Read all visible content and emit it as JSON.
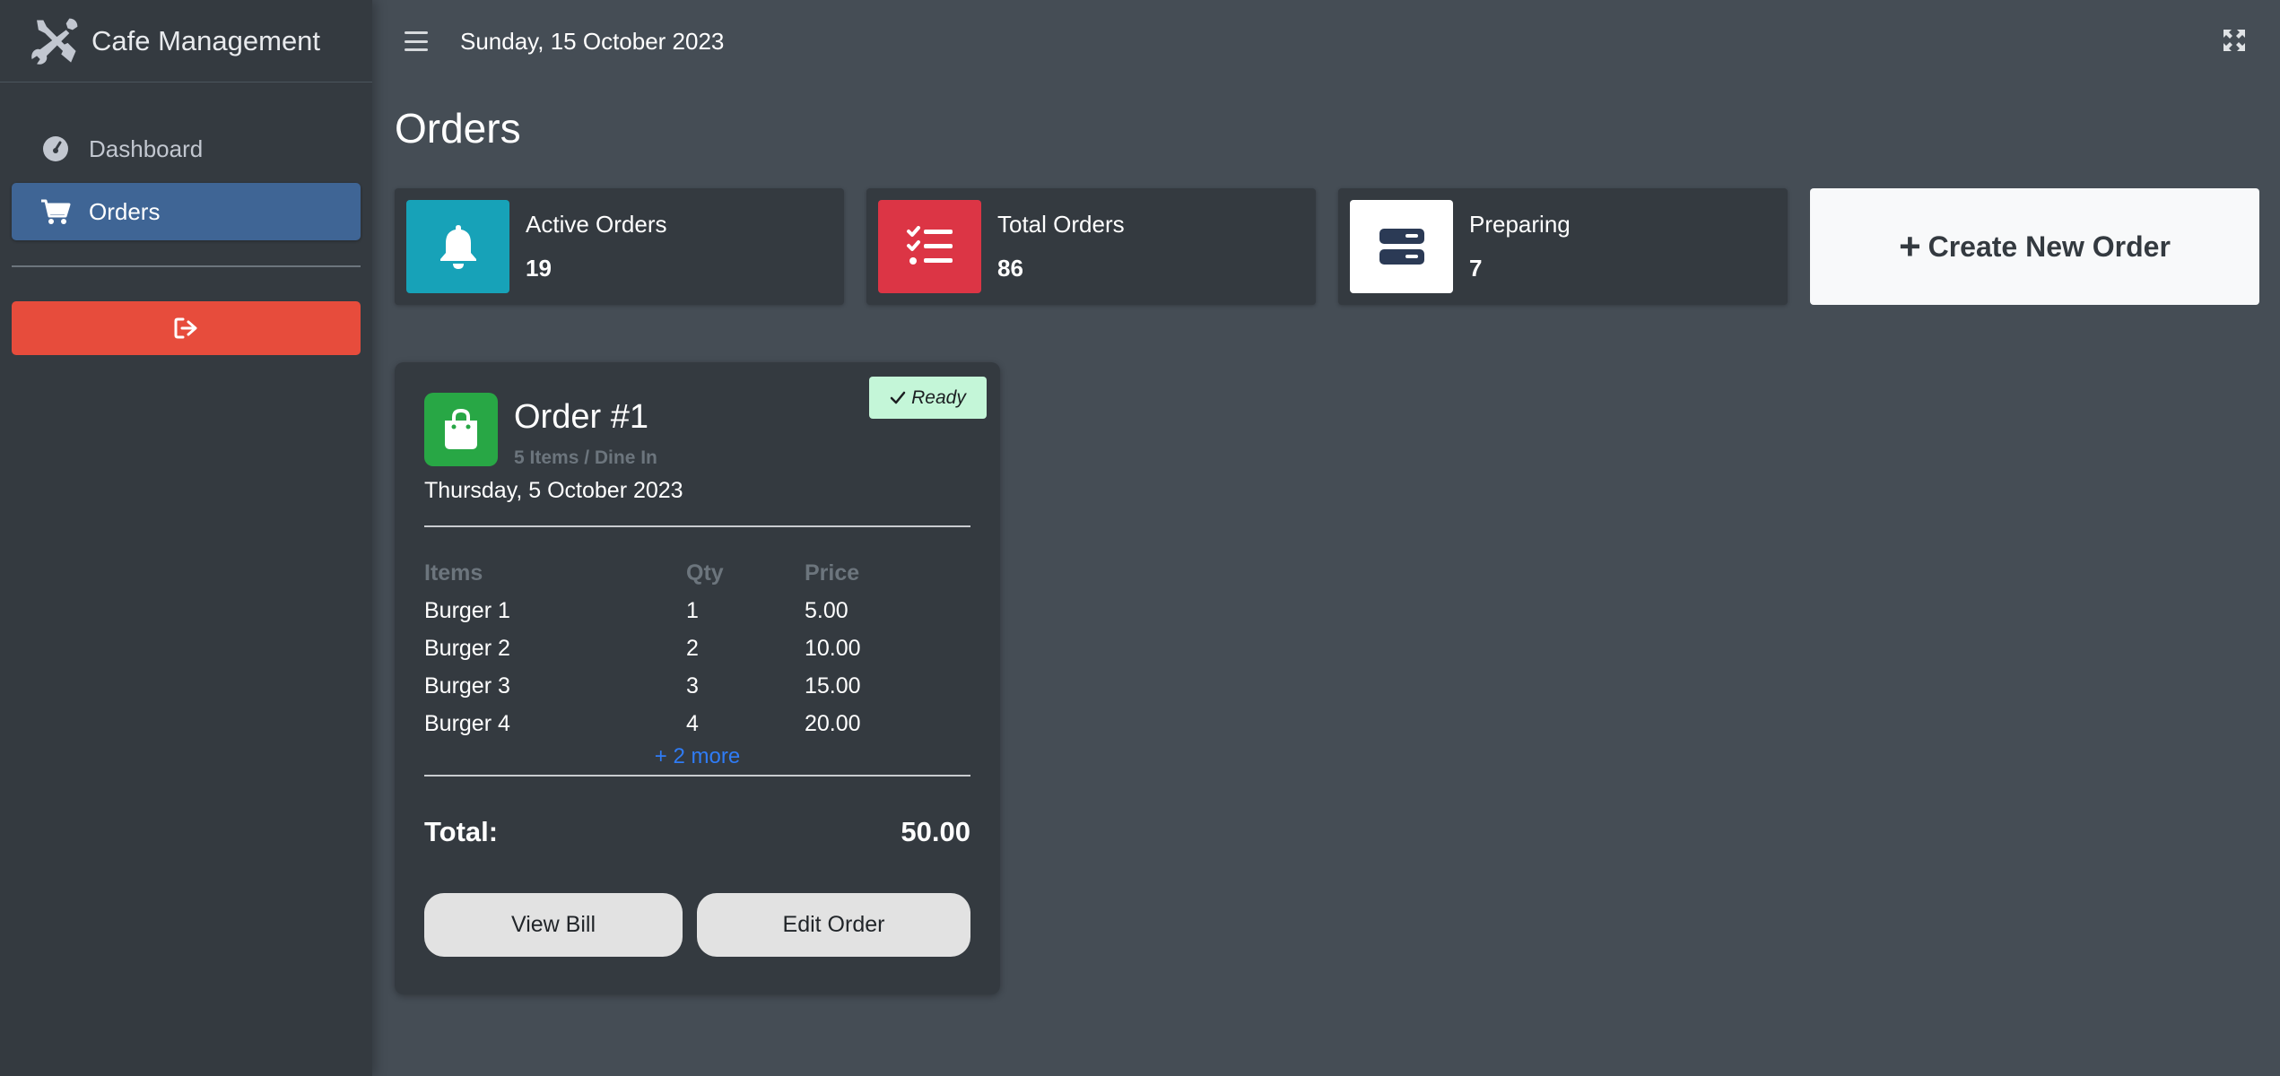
{
  "app": {
    "title": "Cafe Management"
  },
  "sidebar": {
    "items": [
      {
        "label": "Dashboard",
        "icon": "gauge-icon",
        "active": false
      },
      {
        "label": "Orders",
        "icon": "cart-icon",
        "active": true
      }
    ],
    "logout_icon": "sign-out-icon"
  },
  "topbar": {
    "date": "Sunday, 15 October 2023"
  },
  "page": {
    "title": "Orders"
  },
  "stats": [
    {
      "label": "Active Orders",
      "value": "19",
      "icon": "bell-icon",
      "color": "#17a2b8"
    },
    {
      "label": "Total Orders",
      "value": "86",
      "icon": "tasks-icon",
      "color": "#dc3545"
    },
    {
      "label": "Preparing",
      "value": "7",
      "icon": "server-icon",
      "color": "#ffffff"
    }
  ],
  "create": {
    "label": "Create New Order"
  },
  "order": {
    "title": "Order #1",
    "status": "Ready",
    "subtitle": "5 Items / Dine In",
    "date": "Thursday, 5 October 2023",
    "columns": [
      "Items",
      "Qty",
      "Price"
    ],
    "rows": [
      [
        "Burger 1",
        "1",
        "5.00"
      ],
      [
        "Burger 2",
        "2",
        "10.00"
      ],
      [
        "Burger 3",
        "3",
        "15.00"
      ],
      [
        "Burger 4",
        "4",
        "20.00"
      ]
    ],
    "more": "+ 2 more",
    "total_label": "Total:",
    "total_value": "50.00",
    "view_bill": "View Bill",
    "edit_order": "Edit Order"
  },
  "colors": {
    "sidebar_bg": "#343a40",
    "main_bg": "#454d55",
    "active_nav": "#3f6595",
    "logout": "#e74c3c",
    "ready_badge": "#c4f6d8",
    "bag": "#28a745",
    "link": "#2f7cf6"
  }
}
